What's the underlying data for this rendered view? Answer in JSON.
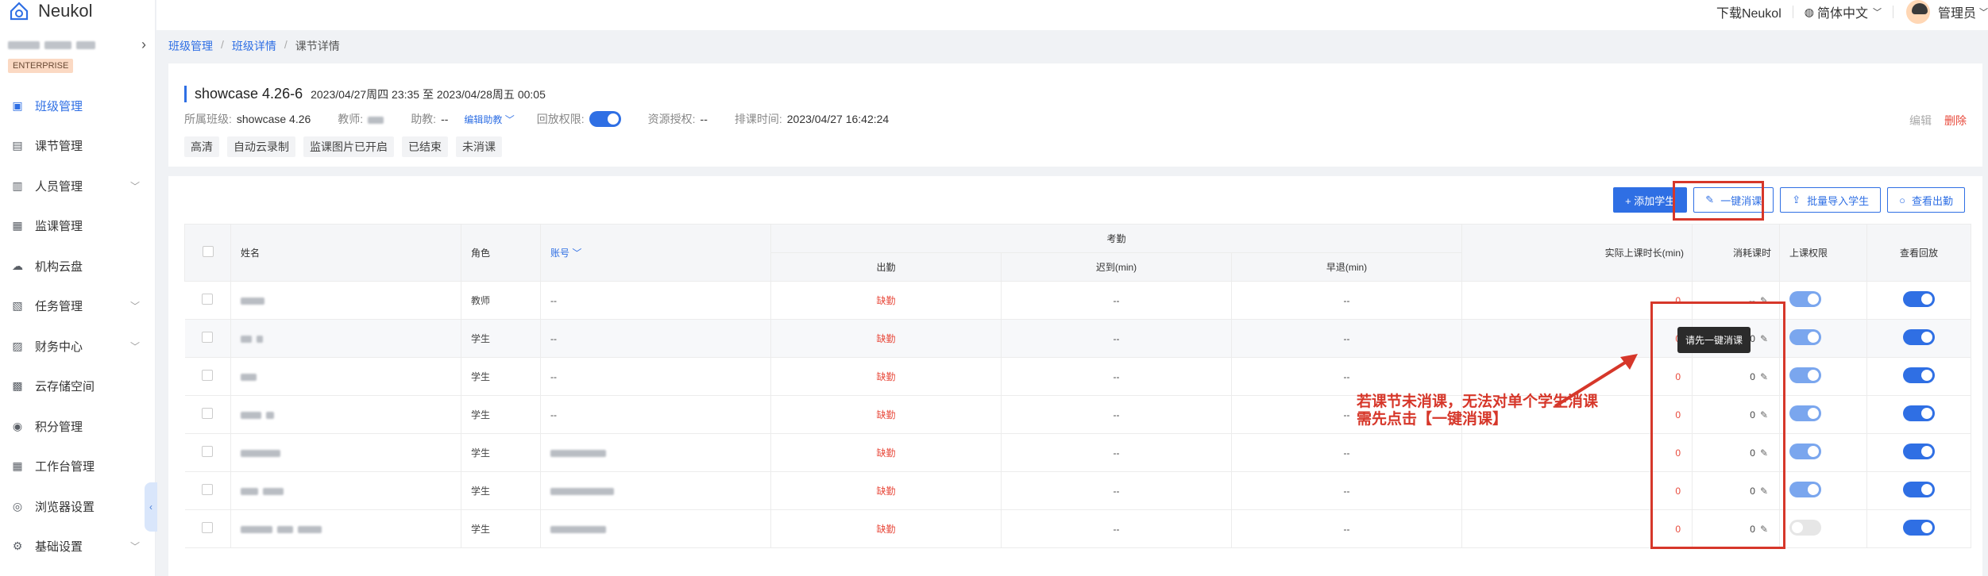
{
  "app": {
    "name": "Neukol"
  },
  "sidebar": {
    "org_badge": "ENTERPRISE",
    "items": [
      {
        "label": "班级管理",
        "icon": "class-icon",
        "active": true,
        "expandable": false
      },
      {
        "label": "课节管理",
        "icon": "lesson-icon",
        "active": false,
        "expandable": false
      },
      {
        "label": "人员管理",
        "icon": "people-icon",
        "active": false,
        "expandable": true
      },
      {
        "label": "监课管理",
        "icon": "monitor-icon",
        "active": false,
        "expandable": false
      },
      {
        "label": "机构云盘",
        "icon": "cloud-icon",
        "active": false,
        "expandable": false
      },
      {
        "label": "任务管理",
        "icon": "task-icon",
        "active": false,
        "expandable": true
      },
      {
        "label": "财务中心",
        "icon": "finance-icon",
        "active": false,
        "expandable": true
      },
      {
        "label": "云存储空间",
        "icon": "storage-icon",
        "active": false,
        "expandable": false
      },
      {
        "label": "积分管理",
        "icon": "points-icon",
        "active": false,
        "expandable": false
      },
      {
        "label": "工作台管理",
        "icon": "workbench-icon",
        "active": false,
        "expandable": false
      },
      {
        "label": "浏览器设置",
        "icon": "browser-icon",
        "active": false,
        "expandable": false
      },
      {
        "label": "基础设置",
        "icon": "settings-icon",
        "active": false,
        "expandable": true
      }
    ]
  },
  "topbar": {
    "download": "下载Neukol",
    "language": "简体中文",
    "user": "管理员"
  },
  "breadcrumb": [
    "班级管理",
    "班级详情",
    "课节详情"
  ],
  "lesson": {
    "title": "showcase 4.26-6",
    "time": "2023/04/27周四 23:35 至 2023/04/28周五 00:05",
    "class_label": "所属班级:",
    "class_value": "showcase 4.26",
    "teacher_label": "教师:",
    "assistant_label": "助教:",
    "assistant_value": "--",
    "edit_assistant": "编辑助教",
    "playback_label": "回放权限:",
    "resource_label": "资源授权:",
    "resource_value": "--",
    "schedule_label": "排课时间:",
    "schedule_value": "2023/04/27 16:42:24",
    "tags": [
      "高清",
      "自动云录制",
      "监课图片已开启",
      "已结束",
      "未消课"
    ],
    "edit": "编辑",
    "delete": "删除"
  },
  "toolbar": {
    "add_student": "+ 添加学生",
    "one_click": "一键消课",
    "batch_import": "批量导入学生",
    "view_attendance": "查看出勤"
  },
  "table": {
    "headers": {
      "name": "姓名",
      "role": "角色",
      "account": "账号",
      "attendance_group": "考勤",
      "attend": "出勤",
      "late": "迟到(min)",
      "early": "早退(min)",
      "actual_duration": "实际上课时长(min)",
      "hours_consumed": "消耗课时",
      "class_permission": "上课权限",
      "view_playback": "查看回放"
    },
    "rows": [
      {
        "role": "教师",
        "account": "--",
        "attend": "缺勤",
        "late": "--",
        "early": "--",
        "duration": "0",
        "consumed": "--",
        "permission": "light",
        "playback": "on"
      },
      {
        "role": "学生",
        "account": "--",
        "attend": "缺勤",
        "late": "--",
        "early": "--",
        "duration": "0",
        "consumed": "0",
        "permission": "light",
        "playback": "on"
      },
      {
        "role": "学生",
        "account": "--",
        "attend": "缺勤",
        "late": "--",
        "early": "--",
        "duration": "0",
        "consumed": "0",
        "permission": "light",
        "playback": "on"
      },
      {
        "role": "学生",
        "account": "--",
        "attend": "缺勤",
        "late": "--",
        "early": "--",
        "duration": "0",
        "consumed": "0",
        "permission": "light",
        "playback": "on"
      },
      {
        "role": "学生",
        "account": "",
        "attend": "缺勤",
        "late": "--",
        "early": "--",
        "duration": "0",
        "consumed": "0",
        "permission": "light",
        "playback": "on"
      },
      {
        "role": "学生",
        "account": "",
        "attend": "缺勤",
        "late": "--",
        "early": "--",
        "duration": "0",
        "consumed": "0",
        "permission": "light",
        "playback": "on"
      },
      {
        "role": "学生",
        "account": "",
        "attend": "缺勤",
        "late": "--",
        "early": "--",
        "duration": "0",
        "consumed": "0",
        "permission": "off",
        "playback": "on"
      }
    ]
  },
  "tooltip": "请先一键消课",
  "annotation": {
    "line1": "若课节未消课，无法对单个学生消课",
    "line2": "需先点击【一键消课】"
  }
}
